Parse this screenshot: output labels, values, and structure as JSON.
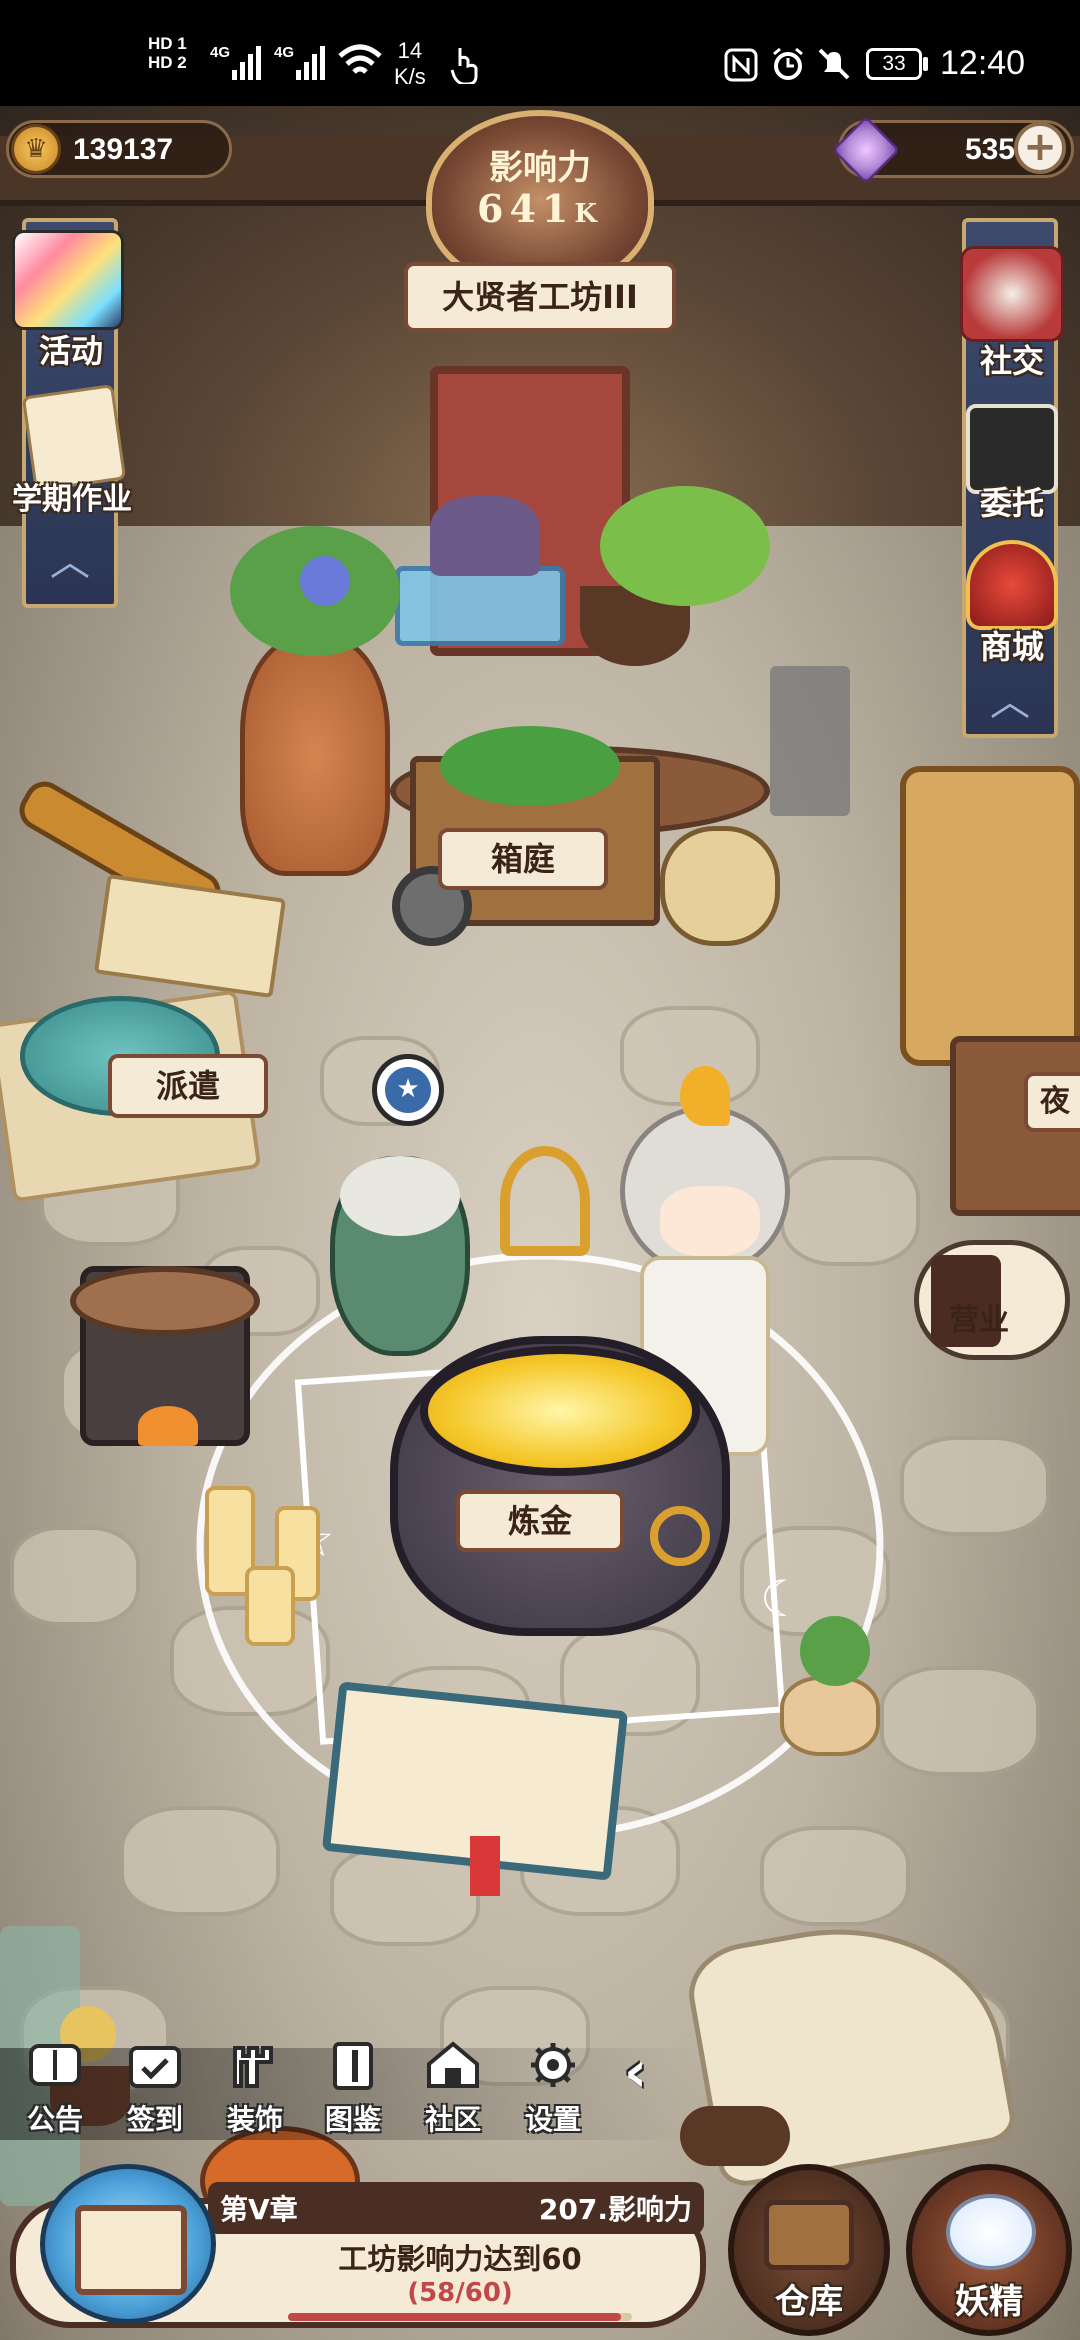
{
  "status_bar": {
    "sim1": "HD 1",
    "sim2": "HD 2",
    "net1": "4G",
    "net2": "4G",
    "speed_value": "14",
    "speed_unit": "K/s",
    "battery": "33",
    "time": "12:40"
  },
  "top_bar": {
    "gold": "139137",
    "gems": "535",
    "influence_title": "影响力",
    "influence_value": "641",
    "influence_unit": "K",
    "workshop_name": "大贤者工坊III"
  },
  "left_menu": [
    {
      "label": "活动"
    },
    {
      "label": "学期作业"
    }
  ],
  "right_menu": [
    {
      "label": "社交"
    },
    {
      "label": "委托"
    },
    {
      "label": "商城"
    }
  ],
  "scene_labels": {
    "garden": "箱庭",
    "dispatch": "派遣",
    "alchemy": "炼金",
    "business": "营业",
    "partial": "夜"
  },
  "toolbar": [
    {
      "label": "公告",
      "icon": "board-icon"
    },
    {
      "label": "签到",
      "icon": "calendar-check-icon"
    },
    {
      "label": "装饰",
      "icon": "castle-icon"
    },
    {
      "label": "图鉴",
      "icon": "book-icon"
    },
    {
      "label": "社区",
      "icon": "house-icon"
    },
    {
      "label": "设置",
      "icon": "gear-icon"
    }
  ],
  "quest": {
    "chapter": "第V章",
    "reward": "207.影响力",
    "task": "工坊影响力达到60",
    "progress": "(58/60)",
    "progress_fraction": 0.967
  },
  "bottom_buttons": {
    "warehouse": "仓库",
    "fairy": "妖精"
  },
  "colors": {
    "banner_blue": "#3d4a6d",
    "frame_gold": "#c7a870",
    "ribbon_bg": "#f5ead6",
    "gem_purple": "#b28bd8"
  }
}
